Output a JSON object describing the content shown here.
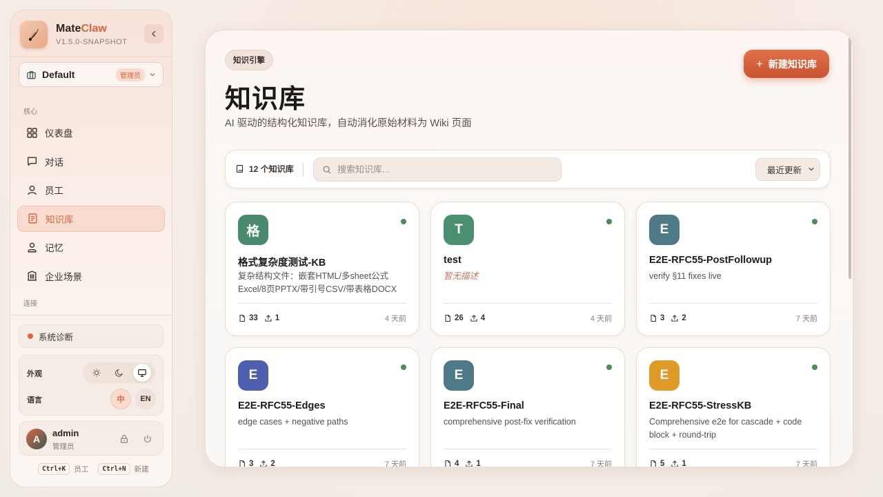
{
  "app": {
    "name_main": "Mate",
    "name_accent": "Claw",
    "version": "V1.5.0-SNAPSHOT"
  },
  "workspace": {
    "name": "Default",
    "role_badge": "管理员"
  },
  "sidebar": {
    "section_core": "核心",
    "items": [
      {
        "label": "仪表盘",
        "icon": "dashboard-icon"
      },
      {
        "label": "对话",
        "icon": "chat-icon"
      },
      {
        "label": "员工",
        "icon": "user-icon"
      },
      {
        "label": "知识库",
        "icon": "book-icon",
        "active": true
      },
      {
        "label": "记忆",
        "icon": "memory-icon"
      },
      {
        "label": "企业场景",
        "icon": "building-icon"
      }
    ],
    "section_connect": "连接",
    "diagnostics": "系统诊断",
    "appearance_label": "外观",
    "language_label": "语言",
    "lang_zh": "中",
    "lang_en": "EN",
    "user": {
      "initial": "A",
      "name": "admin",
      "role": "管理员"
    },
    "shortcuts": [
      {
        "key": "Ctrl+K",
        "label": "员工"
      },
      {
        "key": "Ctrl+N",
        "label": "新建"
      }
    ]
  },
  "main": {
    "chip": "知识引擎",
    "title": "知识库",
    "subtitle": "AI 驱动的结构化知识库，自动消化原始材料为 Wiki 页面",
    "new_button": "新建知识库",
    "count": "12 个知识库",
    "search_placeholder": "搜索知识库...",
    "sort": "最近更新"
  },
  "colors": {
    "accent": "#d9653f",
    "status_online": "#4f8a5c"
  },
  "cards": [
    {
      "initial": "格",
      "color": "#4a8a6c",
      "title": "格式复杂度测试-KB",
      "desc": "复杂结构文件：嵌套HTML/多sheet公式Excel/8页PPTX/带引号CSV/带表格DOCX",
      "docs": "33",
      "uploads": "1",
      "time": "4 天前"
    },
    {
      "initial": "T",
      "color": "#4a9070",
      "title": "test",
      "desc": "暂无描述",
      "empty": true,
      "docs": "26",
      "uploads": "4",
      "time": "4 天前"
    },
    {
      "initial": "E",
      "color": "#4e7a88",
      "title": "E2E-RFC55-PostFollowup",
      "desc": "verify §11 fixes live",
      "docs": "3",
      "uploads": "2",
      "time": "7 天前"
    },
    {
      "initial": "E",
      "color": "#4f5fb0",
      "title": "E2E-RFC55-Edges",
      "desc": "edge cases + negative paths",
      "docs": "3",
      "uploads": "2",
      "time": "7 天前"
    },
    {
      "initial": "E",
      "color": "#4e7a88",
      "title": "E2E-RFC55-Final",
      "desc": "comprehensive post-fix verification",
      "docs": "4",
      "uploads": "1",
      "time": "7 天前"
    },
    {
      "initial": "E",
      "color": "#e09a28",
      "title": "E2E-RFC55-StressKB",
      "desc": "Comprehensive e2e for cascade + code block + round-trip",
      "docs": "5",
      "uploads": "1",
      "time": "7 天前"
    }
  ]
}
